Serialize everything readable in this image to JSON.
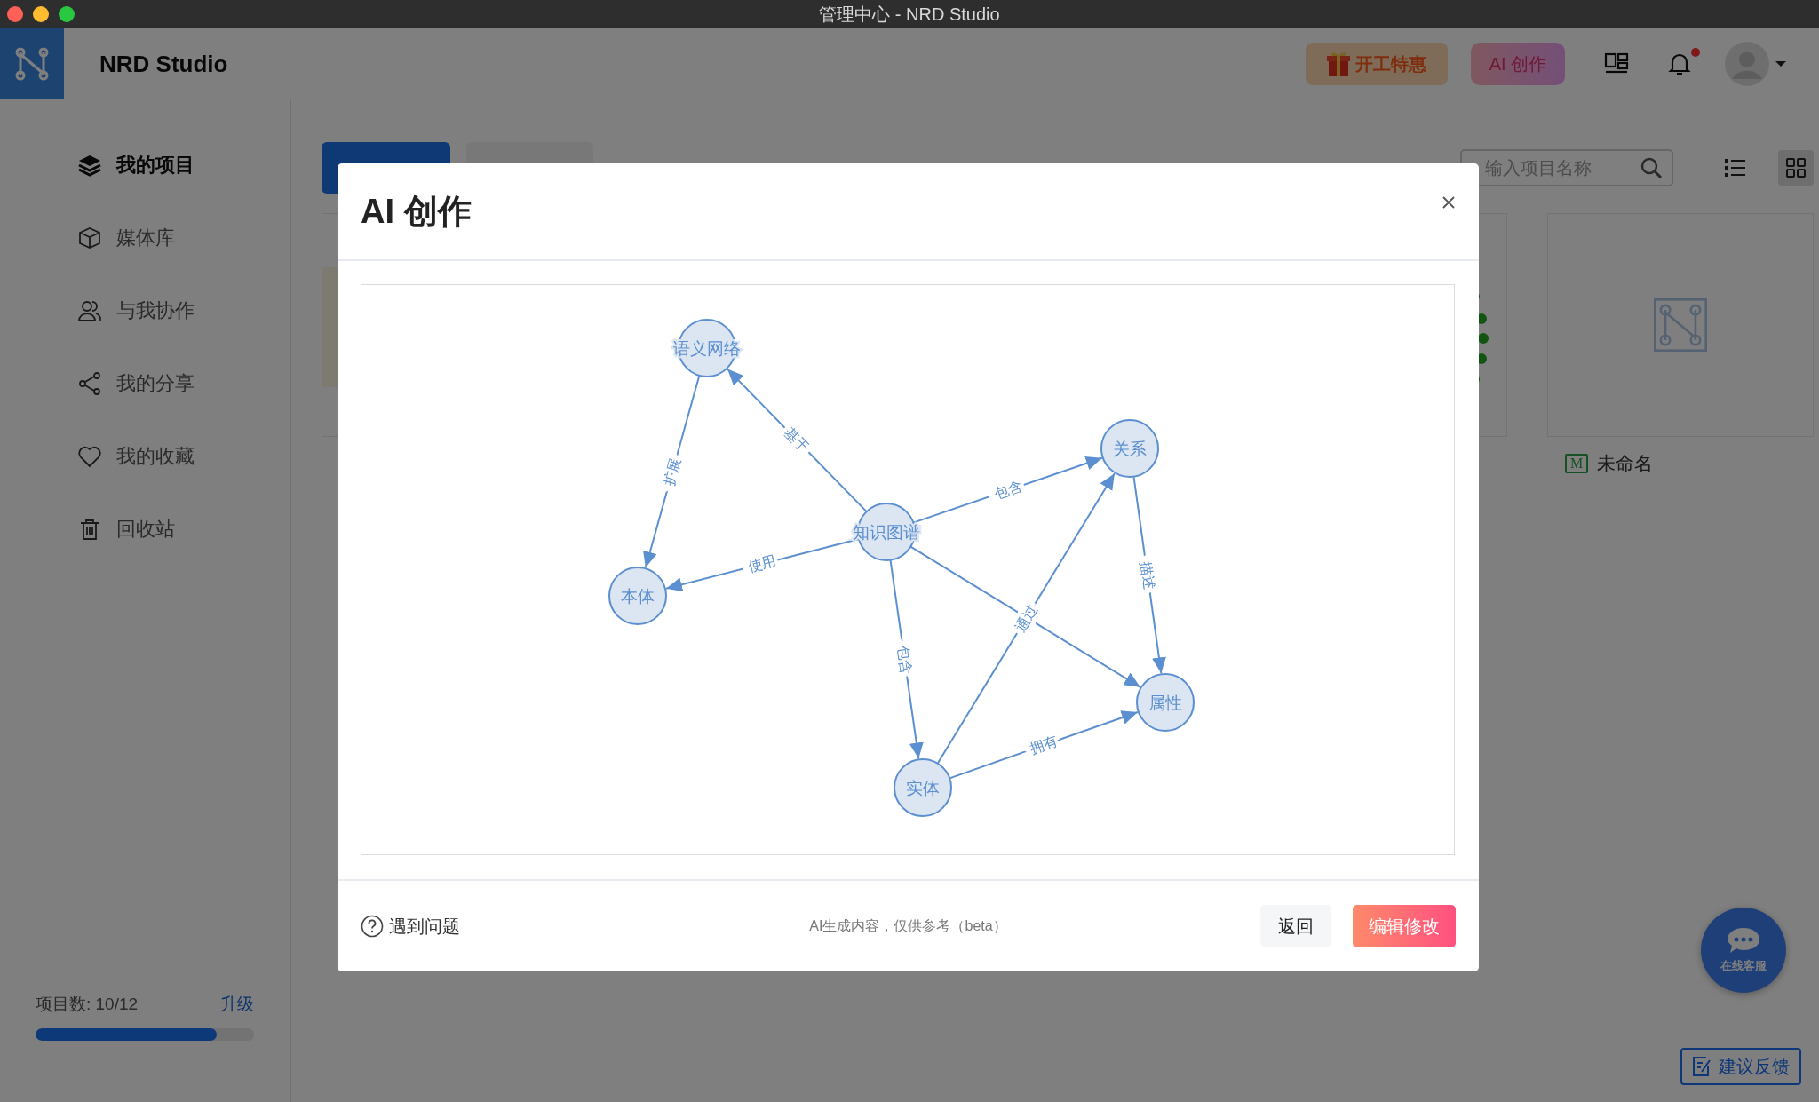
{
  "window": {
    "title": "管理中心 - NRD Studio"
  },
  "header": {
    "brand": "NRD Studio",
    "promo_button": "开工特惠",
    "ai_button": "AI 创作",
    "notification_unread": true
  },
  "sidebar": {
    "items": [
      {
        "label": "我的项目",
        "selected": true
      },
      {
        "label": "媒体库",
        "selected": false
      },
      {
        "label": "与我协作",
        "selected": false
      },
      {
        "label": "我的分享",
        "selected": false
      },
      {
        "label": "我的收藏",
        "selected": false
      },
      {
        "label": "回收站",
        "selected": false
      }
    ],
    "quota": {
      "label": "项目数: 10/12",
      "level": 0.83,
      "upgrade": "升级"
    }
  },
  "toolbar": {
    "search": {
      "placeholder": "输入项目名称"
    },
    "views": [
      {
        "kind": "list",
        "selected": false
      },
      {
        "kind": "grid",
        "selected": true
      }
    ]
  },
  "projects": [
    {
      "kind": "document"
    },
    {
      "kind": "graph"
    },
    {
      "kind": "empty",
      "badge": "M",
      "name": "未命名"
    }
  ],
  "dialog": {
    "title": "AI 创作",
    "graph": {
      "nodes": [
        {
          "label": "语义网络"
        },
        {
          "label": "关系"
        },
        {
          "label": "知识图谱"
        },
        {
          "label": "本体"
        },
        {
          "label": "属性"
        },
        {
          "label": "实体"
        }
      ],
      "edge_labels": [
        "基于",
        "扩展",
        "包含",
        "使用",
        "包含",
        "描述",
        "通过",
        "拥有"
      ]
    },
    "help": "遇到问题",
    "note": "AI生成内容，仅供参考（beta）",
    "buttons": [
      {
        "label": "返回",
        "kind": "secondary"
      },
      {
        "label": "编辑修改",
        "kind": "primary"
      }
    ]
  },
  "chat_button": {
    "label": "在线客服"
  },
  "feedback_button": {
    "label": "建议反馈"
  }
}
